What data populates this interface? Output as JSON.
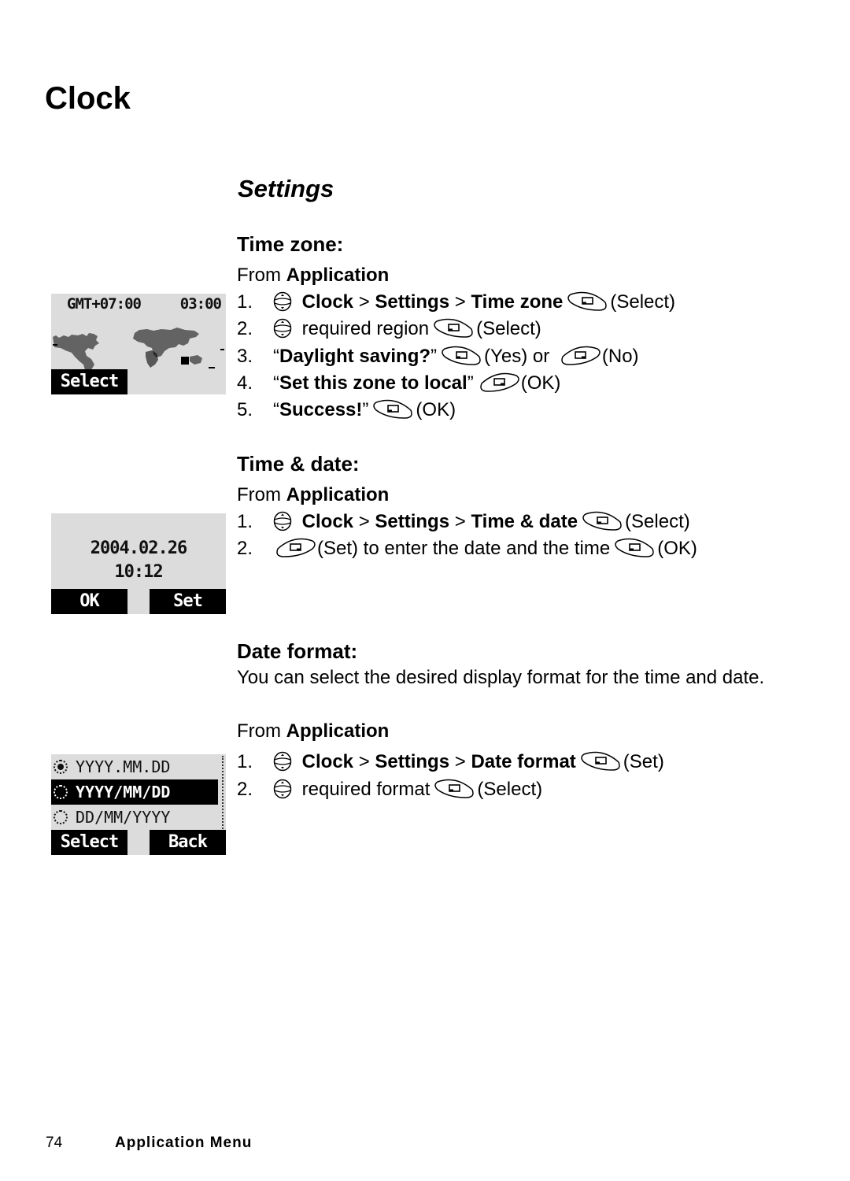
{
  "page": {
    "title": "Clock",
    "section_title": "Settings",
    "footer": {
      "page_number": "74",
      "label": "Application Menu"
    }
  },
  "time_zone": {
    "heading": "Time zone:",
    "from_prefix": "From ",
    "from_location": "Application",
    "screen": {
      "gmt": "GMT+07:00",
      "time": "03:00",
      "left_softkey": "Select"
    },
    "steps": [
      {
        "num": "1.",
        "path": [
          "Clock",
          "Settings",
          "Time zone"
        ],
        "sep": ">",
        "key": "left",
        "action": "(Select)"
      },
      {
        "num": "2.",
        "text": "required region",
        "key": "left",
        "action": "(Select)"
      },
      {
        "num": "3.",
        "quote_open": "“",
        "bold": "Daylight saving?",
        "quote_close": "”",
        "key1": "left",
        "action1": "(Yes) or",
        "key2": "right",
        "action2": "(No)"
      },
      {
        "num": "4.",
        "quote_open": "“",
        "bold": "Set this zone to local",
        "quote_close": "”",
        "key": "right",
        "action": "(OK)"
      },
      {
        "num": "5.",
        "quote_open": "“",
        "bold": "Success!",
        "quote_close": "”",
        "key": "left",
        "action": "(OK)"
      }
    ]
  },
  "time_date": {
    "heading": "Time & date:",
    "from_prefix": "From ",
    "from_location": "Application",
    "screen": {
      "date": "2004.02.26",
      "time": "10:12",
      "left_softkey": "OK",
      "right_softkey": "Set"
    },
    "steps": [
      {
        "num": "1.",
        "path": [
          "Clock",
          "Settings",
          "Time & date"
        ],
        "sep": ">",
        "key": "left",
        "action": "(Select)"
      },
      {
        "num": "2.",
        "key_first": "right",
        "text": "(Set) to enter the date and the time",
        "key": "left",
        "action": "(OK)"
      }
    ]
  },
  "date_format": {
    "heading": "Date format:",
    "description": "You can select the desired display format for the time and date.",
    "from_prefix": "From ",
    "from_location": "Application",
    "screen": {
      "options": [
        {
          "label": "YYYY.MM.DD",
          "checked": true,
          "highlighted": false
        },
        {
          "label": "YYYY/MM/DD",
          "checked": false,
          "highlighted": true
        },
        {
          "label": "DD/MM/YYYY",
          "checked": false,
          "highlighted": false
        }
      ],
      "left_softkey": "Select",
      "right_softkey": "Back"
    },
    "steps": [
      {
        "num": "1.",
        "path": [
          "Clock",
          "Settings",
          "Date format"
        ],
        "sep": ">",
        "key": "left",
        "action": "(Set)"
      },
      {
        "num": "2.",
        "text": "required format",
        "key": "left",
        "action": "(Select)"
      }
    ]
  },
  "icons": {
    "nav_key": "navigation-key-icon",
    "left_softkey": "left-softkey-icon",
    "right_softkey": "right-softkey-icon"
  }
}
